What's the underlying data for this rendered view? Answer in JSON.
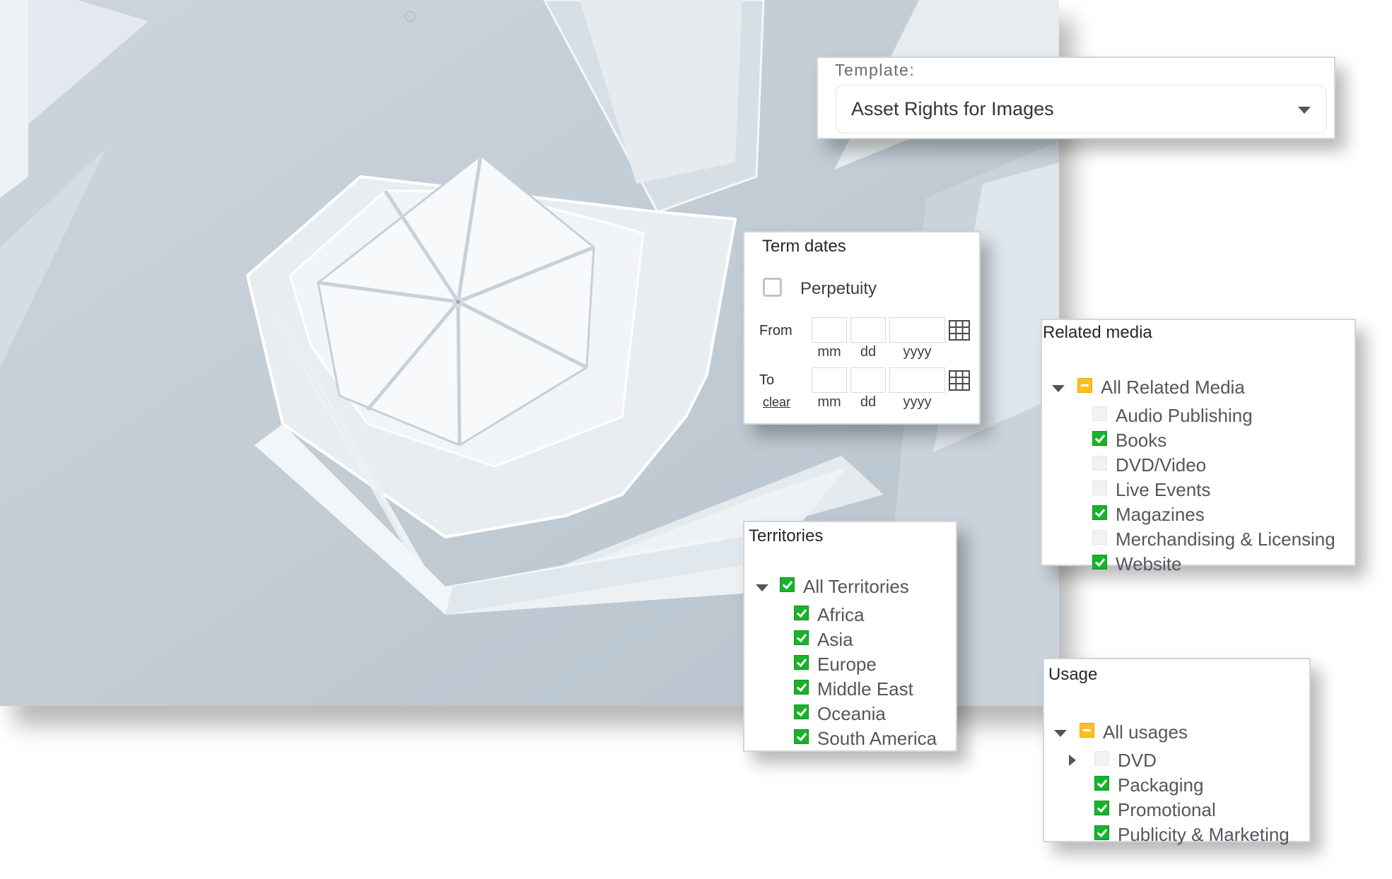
{
  "template": {
    "label": "Template:",
    "selected": "Asset Rights for Images"
  },
  "term_dates": {
    "title": "Term dates",
    "perpetuity": {
      "label": "Perpetuity",
      "checked": false
    },
    "from": {
      "label": "From",
      "mm": "",
      "dd": "",
      "yyyy": ""
    },
    "to": {
      "label": "To",
      "mm": "",
      "dd": "",
      "yyyy": ""
    },
    "hints": {
      "mm": "mm",
      "dd": "dd",
      "yyyy": "yyyy"
    },
    "clear_label": "clear",
    "calendar_icon": "calendar-grid-icon"
  },
  "related_media": {
    "title": "Related media",
    "root": {
      "label": "All Related Media",
      "state": "partial",
      "expanded": true
    },
    "items": [
      {
        "label": "Audio Publishing",
        "state": "unchecked"
      },
      {
        "label": "Books",
        "state": "checked"
      },
      {
        "label": "DVD/Video",
        "state": "unchecked"
      },
      {
        "label": "Live Events",
        "state": "unchecked"
      },
      {
        "label": "Magazines",
        "state": "checked"
      },
      {
        "label": "Merchandising & Licensing",
        "state": "unchecked"
      },
      {
        "label": "Website",
        "state": "checked"
      }
    ]
  },
  "territories": {
    "title": "Territories",
    "root": {
      "label": "All Territories",
      "state": "checked",
      "expanded": true
    },
    "items": [
      {
        "label": "Africa",
        "state": "checked"
      },
      {
        "label": "Asia",
        "state": "checked"
      },
      {
        "label": "Europe",
        "state": "checked"
      },
      {
        "label": "Middle East",
        "state": "checked"
      },
      {
        "label": "Oceania",
        "state": "checked"
      },
      {
        "label": "South America",
        "state": "checked"
      }
    ]
  },
  "usage": {
    "title": "Usage",
    "root": {
      "label": "All usages",
      "state": "partial",
      "expanded": true
    },
    "items": [
      {
        "label": "DVD",
        "state": "unchecked",
        "collapsible": true,
        "expanded": false
      },
      {
        "label": "Packaging",
        "state": "checked"
      },
      {
        "label": "Promotional",
        "state": "checked"
      },
      {
        "label": "Publicity & Marketing",
        "state": "checked"
      }
    ]
  },
  "colors": {
    "checked": "#18b32a",
    "partial": "#fbbf24",
    "unchecked": "#f2f2f3",
    "photo_tint": "#c3cdd5"
  }
}
